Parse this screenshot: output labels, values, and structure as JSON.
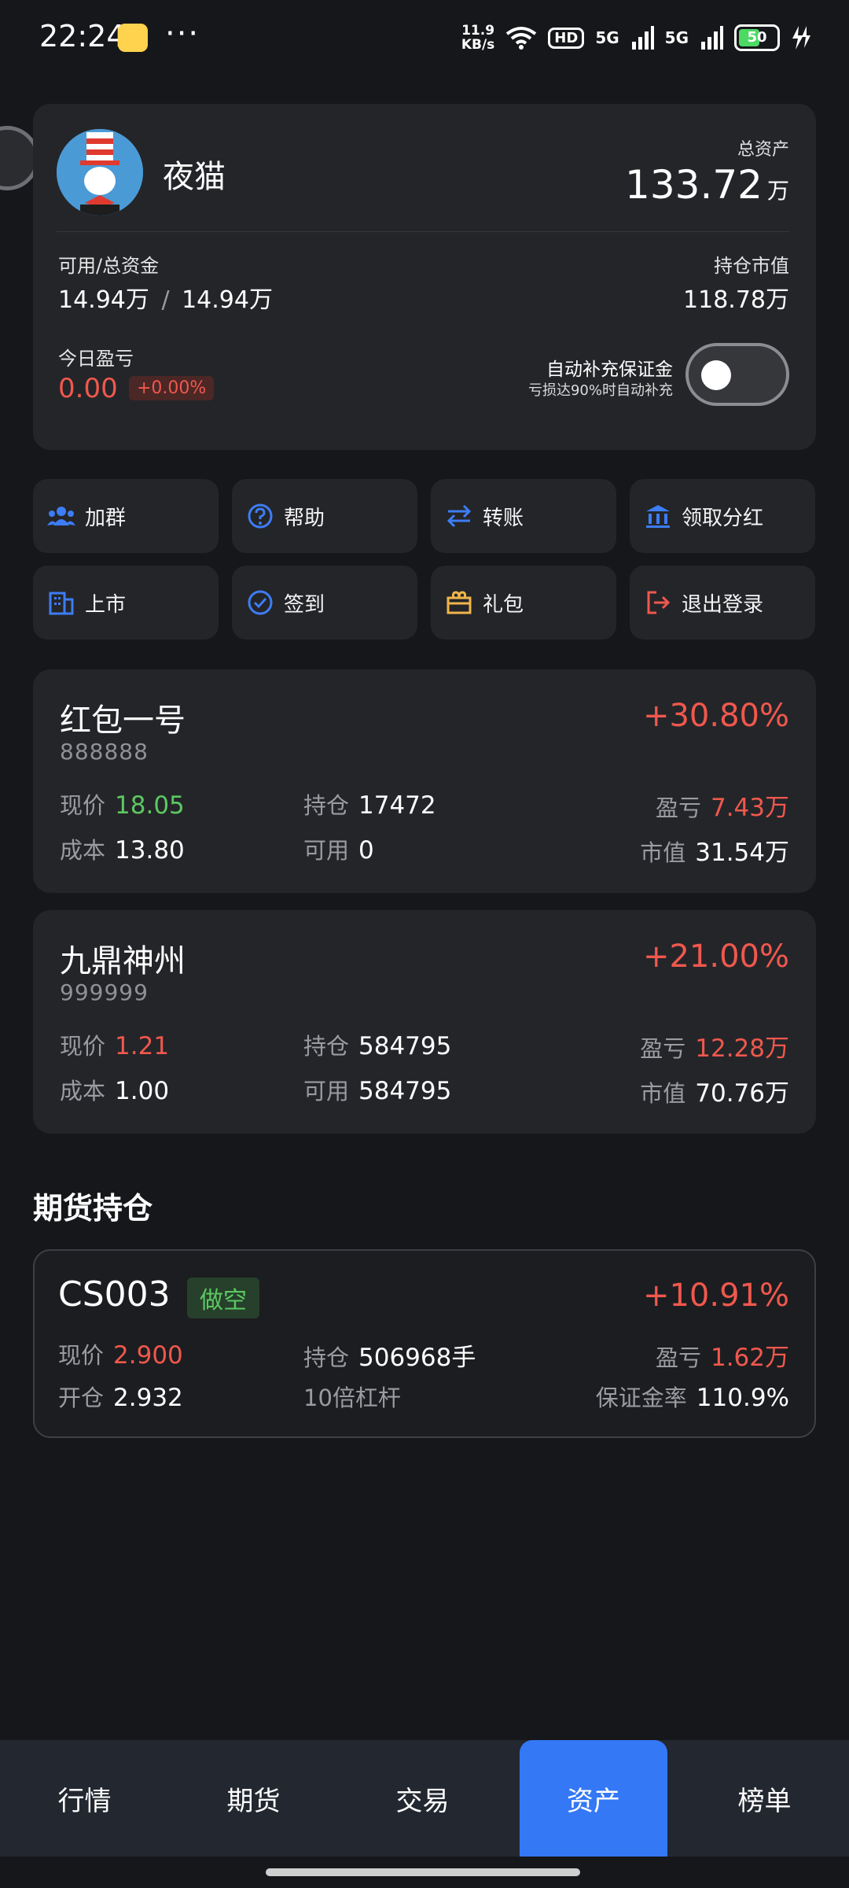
{
  "status_bar": {
    "time": "22:24",
    "more": "···",
    "net_speed_value": "11.9",
    "net_speed_unit": "KB/s",
    "hd": "HD",
    "signal_1": "5G",
    "signal_2": "5G",
    "battery": "50"
  },
  "account": {
    "username": "夜猫",
    "total_label": "总资产",
    "total_value": "133.72",
    "total_unit": "万",
    "funds_label": "可用/总资金",
    "available_funds": "14.94万",
    "separator": "/",
    "total_funds": "14.94万",
    "holding_label": "持仓市值",
    "holding_value": "118.78万",
    "today_pl_label": "今日盈亏",
    "today_pl_value": "0.00",
    "today_pl_pct": "+0.00%",
    "auto_margin_label": "自动补充保证金",
    "auto_margin_sub": "亏损达90%时自动补充",
    "auto_margin_enabled": false
  },
  "actions": [
    {
      "label": "加群",
      "icon": "group-icon",
      "color": "#3d7df5"
    },
    {
      "label": "帮助",
      "icon": "help-icon",
      "color": "#3d7df5"
    },
    {
      "label": "转账",
      "icon": "transfer-icon",
      "color": "#3d7df5"
    },
    {
      "label": "领取分红",
      "icon": "bank-icon",
      "color": "#3d7df5"
    },
    {
      "label": "上市",
      "icon": "building-icon",
      "color": "#3d7df5"
    },
    {
      "label": "签到",
      "icon": "check-circle-icon",
      "color": "#3d7df5"
    },
    {
      "label": "礼包",
      "icon": "gift-icon",
      "color": "#f0b54a"
    },
    {
      "label": "退出登录",
      "icon": "logout-icon",
      "color": "#f0584d"
    }
  ],
  "labels": {
    "price": "现价",
    "position": "持仓",
    "profit": "盈亏",
    "cost": "成本",
    "available": "可用",
    "market_value": "市值",
    "open": "开仓",
    "margin_ratio": "保证金率"
  },
  "stocks": [
    {
      "name": "红包一号",
      "code": "888888",
      "change_pct": "+30.80%",
      "price": "18.05",
      "position": "17472",
      "profit": "7.43万",
      "cost": "13.80",
      "available": "0",
      "market_value": "31.54万"
    },
    {
      "name": "九鼎神州",
      "code": "999999",
      "change_pct": "+21.00%",
      "price": "1.21",
      "position": "584795",
      "profit": "12.28万",
      "cost": "1.00",
      "available": "584795",
      "market_value": "70.76万"
    }
  ],
  "futures_section_title": "期货持仓",
  "futures": {
    "name": "CS003",
    "direction": "做空",
    "change_pct": "+10.91%",
    "price": "2.900",
    "position": "506968手",
    "profit": "1.62万",
    "open_price": "2.932",
    "leverage": "10倍杠杆",
    "margin_ratio": "110.9%"
  },
  "nav": [
    {
      "label": "行情"
    },
    {
      "label": "期货"
    },
    {
      "label": "交易"
    },
    {
      "label": "资产",
      "active": true
    },
    {
      "label": "榜单"
    }
  ]
}
